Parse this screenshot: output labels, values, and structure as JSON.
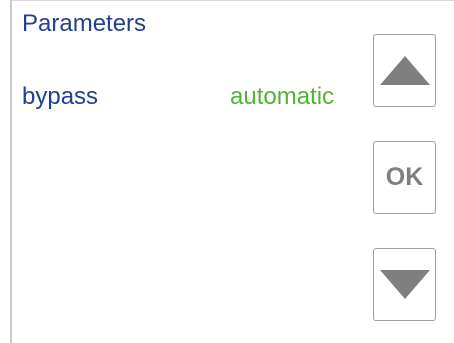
{
  "screen": {
    "title": "Parameters"
  },
  "parameter": {
    "label": "bypass",
    "value": "automatic"
  },
  "buttons": {
    "up_icon": "triangle-up-icon",
    "ok_label": "OK",
    "down_icon": "triangle-down-icon"
  },
  "colors": {
    "title_text": "#21408f",
    "label_text": "#21408f",
    "value_text": "#52b234",
    "button_border": "#a0a0a0",
    "button_glyph": "#7f7f7f"
  }
}
